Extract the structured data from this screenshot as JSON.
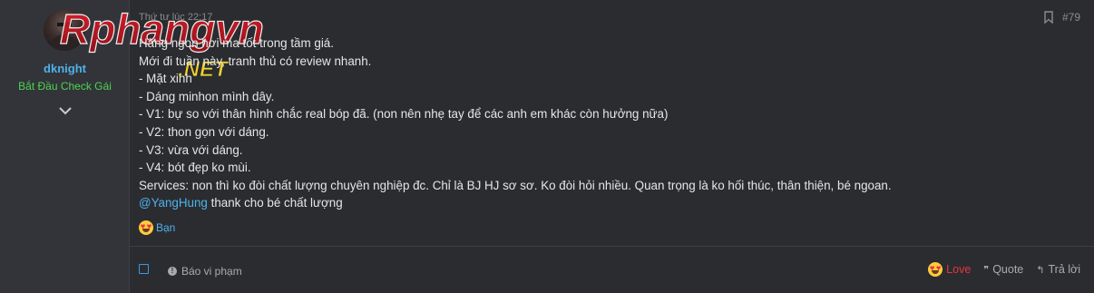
{
  "user": {
    "name": "dknight",
    "title": "Bắt Đầu Check Gái"
  },
  "logo": {
    "text_main": "Rphangvn",
    "text_sub": ".NET"
  },
  "post": {
    "date": "Thứ tư lúc 22:17",
    "number": "#79",
    "lines": [
      "Hàng ngon hơi ma tốt trong tầm giá.",
      "Mới đi tuần này, tranh thủ có review nhanh.",
      "- Mặt xinh",
      "- Dáng minhon mình dây.",
      "- V1: bự so với thân hình chắc real bóp đã. (non nên nhẹ tay để các anh em khác còn hưởng nữa)",
      "- V2: thon gọn với dáng.",
      "- V3: vừa với dáng.",
      "- V4: bót đẹp ko mùi.",
      "Services: non thì ko đòi chất lượng chuyên nghiệp đc. Chỉ là BJ HJ sơ sơ. Ko đòi hỏi nhiều. Quan trọng là ko hối thúc, thân thiện, bé ngoan."
    ],
    "mention": "@YangHung",
    "mention_tail": " thank cho bé chất lượng"
  },
  "reactions": {
    "label": "Bạn"
  },
  "footer": {
    "report": "Báo vi phạm",
    "love": "Love",
    "quote": "Quote",
    "reply": "Trả lời"
  },
  "colors": {
    "link": "#4db2ec",
    "user_title": "#4ed34e",
    "love": "#e2373f",
    "background": "#2b2c30",
    "sidebar": "#323439"
  }
}
